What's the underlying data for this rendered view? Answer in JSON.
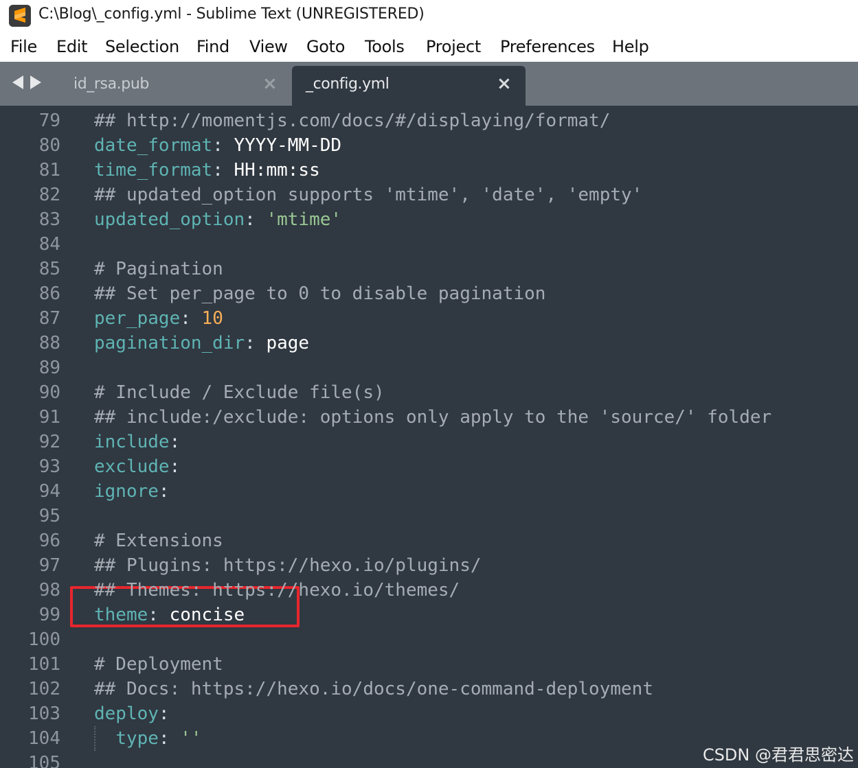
{
  "window": {
    "title": "C:\\Blog\\_config.yml - Sublime Text (UNREGISTERED)",
    "icon": "sublime-text-icon"
  },
  "menu": [
    "File",
    "Edit",
    "Selection",
    "Find",
    "View",
    "Goto",
    "Tools",
    "Project",
    "Preferences",
    "Help"
  ],
  "tabs": [
    {
      "label": "id_rsa.pub",
      "active": false
    },
    {
      "label": "_config.yml",
      "active": true
    }
  ],
  "editor": {
    "lines": [
      {
        "n": "79",
        "parts": [
          [
            "comment",
            "## http://momentjs.com/docs/#/displaying/format/"
          ]
        ]
      },
      {
        "n": "80",
        "parts": [
          [
            "key",
            "date_format"
          ],
          [
            "punct",
            ": "
          ],
          [
            "val",
            "YYYY-MM-DD"
          ]
        ]
      },
      {
        "n": "81",
        "parts": [
          [
            "key",
            "time_format"
          ],
          [
            "punct",
            ": "
          ],
          [
            "val",
            "HH:mm:ss"
          ]
        ]
      },
      {
        "n": "82",
        "parts": [
          [
            "comment",
            "## updated_option supports 'mtime', 'date', 'empty'"
          ]
        ]
      },
      {
        "n": "83",
        "parts": [
          [
            "key",
            "updated_option"
          ],
          [
            "punct",
            ": "
          ],
          [
            "str",
            "'mtime'"
          ]
        ]
      },
      {
        "n": "84",
        "parts": []
      },
      {
        "n": "85",
        "parts": [
          [
            "comment",
            "# Pagination"
          ]
        ]
      },
      {
        "n": "86",
        "parts": [
          [
            "comment",
            "## Set per_page to 0 to disable pagination"
          ]
        ]
      },
      {
        "n": "87",
        "parts": [
          [
            "key",
            "per_page"
          ],
          [
            "punct",
            ": "
          ],
          [
            "num",
            "10"
          ]
        ]
      },
      {
        "n": "88",
        "parts": [
          [
            "key",
            "pagination_dir"
          ],
          [
            "punct",
            ": "
          ],
          [
            "val",
            "page"
          ]
        ]
      },
      {
        "n": "89",
        "parts": []
      },
      {
        "n": "90",
        "parts": [
          [
            "comment",
            "# Include / Exclude file(s)"
          ]
        ]
      },
      {
        "n": "91",
        "parts": [
          [
            "comment",
            "## include:/exclude: options only apply to the 'source/' folder"
          ]
        ]
      },
      {
        "n": "92",
        "parts": [
          [
            "key",
            "include"
          ],
          [
            "punct",
            ":"
          ]
        ]
      },
      {
        "n": "93",
        "parts": [
          [
            "key",
            "exclude"
          ],
          [
            "punct",
            ":"
          ]
        ]
      },
      {
        "n": "94",
        "parts": [
          [
            "key",
            "ignore"
          ],
          [
            "punct",
            ":"
          ]
        ]
      },
      {
        "n": "95",
        "parts": []
      },
      {
        "n": "96",
        "parts": [
          [
            "comment",
            "# Extensions"
          ]
        ]
      },
      {
        "n": "97",
        "parts": [
          [
            "comment",
            "## Plugins: https://hexo.io/plugins/"
          ]
        ]
      },
      {
        "n": "98",
        "parts": [
          [
            "comment",
            "## Themes: https://hexo.io/themes/"
          ]
        ]
      },
      {
        "n": "99",
        "parts": [
          [
            "key",
            "theme"
          ],
          [
            "punct",
            ": "
          ],
          [
            "val",
            "concise"
          ]
        ]
      },
      {
        "n": "100",
        "parts": []
      },
      {
        "n": "101",
        "parts": [
          [
            "comment",
            "# Deployment"
          ]
        ]
      },
      {
        "n": "102",
        "parts": [
          [
            "comment",
            "## Docs: https://hexo.io/docs/one-command-deployment"
          ]
        ]
      },
      {
        "n": "103",
        "parts": [
          [
            "key",
            "deploy"
          ],
          [
            "punct",
            ":"
          ]
        ]
      },
      {
        "n": "104",
        "parts": [
          [
            "punct",
            "  "
          ],
          [
            "key",
            "type"
          ],
          [
            "punct",
            ": "
          ],
          [
            "str",
            "''"
          ]
        ]
      },
      {
        "n": "105",
        "parts": []
      }
    ]
  },
  "watermark": "CSDN @君君思密达",
  "colors": {
    "editor_bg": "#303841",
    "comment": "#a6acb4",
    "key": "#5fb4b4",
    "number": "#f9ae58",
    "string": "#99c794",
    "highlight_box": "#e8262d"
  }
}
